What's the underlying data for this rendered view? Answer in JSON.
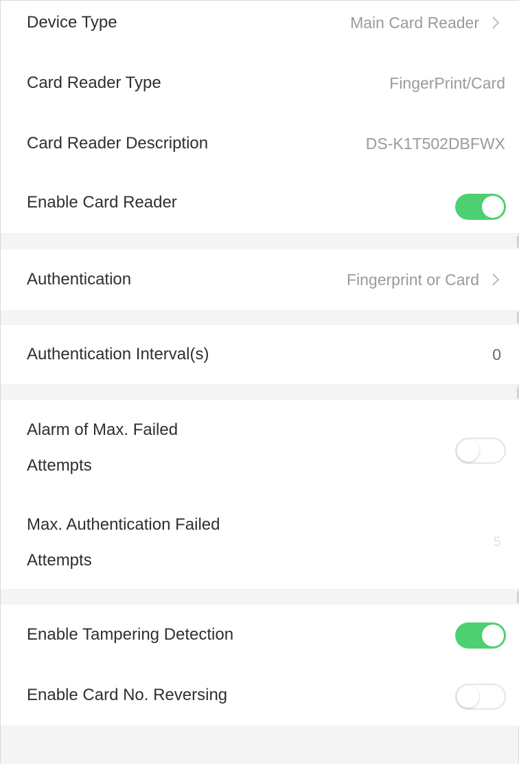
{
  "colors": {
    "toggle_on": "#4cd071",
    "background": "#f4f4f4",
    "label": "#2f2f2f",
    "value": "#9a9a9a"
  },
  "general": {
    "device_type": {
      "label": "Device Type",
      "value": "Main Card Reader",
      "icon": "chevron-right-icon"
    },
    "card_reader_type": {
      "label": "Card Reader Type",
      "value": "FingerPrint/Card"
    },
    "card_reader_description": {
      "label": "Card Reader Description",
      "value": "DS-K1T502DBFWX"
    },
    "enable_card_reader": {
      "label": "Enable Card Reader",
      "enabled": true
    }
  },
  "authentication": {
    "label": "Authentication",
    "value": "Fingerprint or Card",
    "icon": "chevron-right-icon"
  },
  "authentication_interval": {
    "label": "Authentication Interval(s)",
    "value": "0"
  },
  "failed_attempts": {
    "alarm": {
      "label_line1": "Alarm of Max. Failed",
      "label_line2": "Attempts",
      "enabled": false
    },
    "max_failed": {
      "label_line1": "Max. Authentication Failed",
      "label_line2": "Attempts",
      "value": "5"
    }
  },
  "detection": {
    "tampering": {
      "label": "Enable Tampering Detection",
      "enabled": true
    },
    "card_no_reversing": {
      "label": "Enable Card No. Reversing",
      "enabled": false
    }
  }
}
